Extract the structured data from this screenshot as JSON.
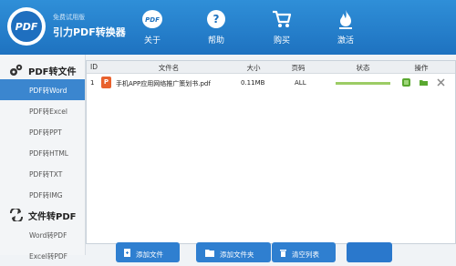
{
  "header": {
    "brand_sub": "免费试用版",
    "brand_title": "引力PDF转换器",
    "logo_text": "PDF",
    "nav": [
      {
        "label": "关于",
        "icon": "pdf-badge-icon"
      },
      {
        "label": "帮助",
        "icon": "help-icon"
      },
      {
        "label": "购买",
        "icon": "cart-icon"
      },
      {
        "label": "激活",
        "icon": "flame-icon"
      }
    ]
  },
  "sidebar": {
    "group1": {
      "label": "PDF转文件",
      "icon": "gears-icon"
    },
    "items1": [
      "PDF转Word",
      "PDF转Excel",
      "PDF转PPT",
      "PDF转HTML",
      "PDF转TXT",
      "PDF转IMG"
    ],
    "group2": {
      "label": "文件转PDF",
      "icon": "convert-arrows-icon"
    },
    "items2": [
      "Word转PDF",
      "Excel转PDF"
    ]
  },
  "table": {
    "headers": [
      "ID",
      "文件名",
      "大小",
      "页码",
      "状态",
      "操作"
    ],
    "rows": [
      {
        "id": "1",
        "icon_text": "P",
        "file_name": "手机APP应用网络推广策划书.pdf",
        "size": "0.11MB",
        "pages": "ALL",
        "progress": 1.0
      }
    ]
  },
  "buttons": {
    "add_file": "添加文件",
    "add_folder": "添加文件夹",
    "clear_list": "清空列表"
  },
  "colors": {
    "header_blue": "#1e72c0",
    "active_item": "#3b86cf",
    "ppt_orange": "#e8612d",
    "progress_green": "#9ccc65"
  }
}
